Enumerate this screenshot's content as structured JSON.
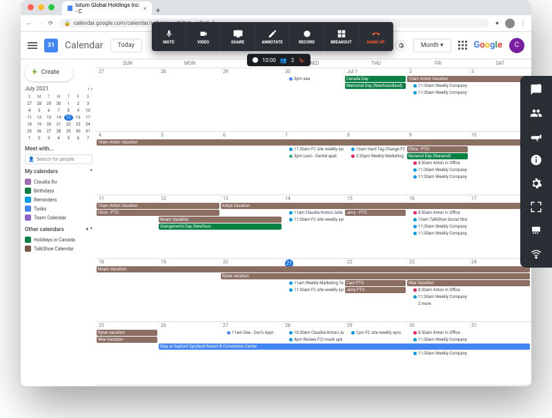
{
  "browser": {
    "tab_title": "Iotum Global Holdings Inc. - C",
    "url": "calendar.google.com/calendar/u/0/r/month?tab=rc&pli=1"
  },
  "header": {
    "app": "Calendar",
    "today": "Today",
    "view": "Month",
    "google": "Google",
    "avatar": "C"
  },
  "toolbar": {
    "mute": "MUTE",
    "video": "VIDEO",
    "share": "SHARE",
    "annotate": "ANNOTATE",
    "record": "RECORD",
    "breakout": "BREAKOUT",
    "hangup": "HANG UP"
  },
  "pill": {
    "time": "10:00",
    "count": "2"
  },
  "sidebar": {
    "create": "Create",
    "month_label": "July 2021",
    "dow": [
      "S",
      "M",
      "T",
      "W",
      "T",
      "F",
      "S"
    ],
    "mini_rows": [
      [
        "27",
        "28",
        "29",
        "30",
        "1",
        "2",
        "3"
      ],
      [
        "4",
        "5",
        "6",
        "7",
        "8",
        "9",
        "10"
      ],
      [
        "11",
        "12",
        "13",
        "14",
        "15",
        "16",
        "17"
      ],
      [
        "18",
        "19",
        "20",
        "21",
        "22",
        "23",
        "24"
      ],
      [
        "25",
        "26",
        "27",
        "28",
        "29",
        "30",
        "31"
      ],
      [
        "1",
        "2",
        "3",
        "4",
        "5",
        "6",
        "7"
      ]
    ],
    "mini_today": "15",
    "meet_label": "Meet with...",
    "search_ph": "Search for people",
    "mycal_label": "My calendars",
    "mycals": [
      {
        "label": "Claudia Xu",
        "color": "#9e69af"
      },
      {
        "label": "Birthdays",
        "color": "#0b8043"
      },
      {
        "label": "Reminders",
        "color": "#039be5"
      },
      {
        "label": "Tasks",
        "color": "#4285f4"
      },
      {
        "label": "Team Calendar",
        "color": "#8e63ce"
      }
    ],
    "other_label": "Other calendars",
    "others": [
      {
        "label": "Holidays in Canada",
        "color": "#0b8043"
      },
      {
        "label": "TalkShoe Calendar",
        "color": "#795548"
      }
    ]
  },
  "grid": {
    "dow": [
      "Sun",
      "Mon",
      "Tue",
      "Wed",
      "Thu",
      "Fri",
      "Sat"
    ],
    "weeks": [
      {
        "dates": [
          "27",
          "28",
          "29",
          "30",
          "Jul 1",
          "2",
          "3"
        ],
        "events": [
          {
            "col": 3,
            "span": 1,
            "row": 0,
            "kind": "dot",
            "dotcolor": "#4285f4",
            "text": "3pm sea"
          },
          {
            "col": 4,
            "span": 1,
            "row": 0,
            "bg": "#0b8043",
            "text": "Canada Day"
          },
          {
            "col": 4,
            "span": 1,
            "row": 1,
            "bg": "#0b8043",
            "text": "Memorial Day (Newfoundland)"
          },
          {
            "col": 5,
            "span": 2,
            "row": 0,
            "bg": "#8d6e63",
            "text": "10am Anton Vacation"
          },
          {
            "col": 5,
            "span": 1,
            "row": 1,
            "kind": "dot",
            "dotcolor": "#039be5",
            "text": "11:30am Weekly Company"
          },
          {
            "col": 5,
            "span": 1,
            "row": 2,
            "kind": "dot",
            "dotcolor": "#039be5",
            "text": "11:30am Weekly Company"
          }
        ]
      },
      {
        "dates": [
          "4",
          "5",
          "6",
          "7",
          "8",
          "9",
          "10"
        ],
        "events": [
          {
            "col": 0,
            "span": 7,
            "row": 0,
            "bg": "#8d6e63",
            "text": "10am Anton Vacation"
          },
          {
            "col": 3,
            "span": 1,
            "row": 1,
            "kind": "dot",
            "dotcolor": "#039be5",
            "text": "11:30am FC site weekly syn"
          },
          {
            "col": 3,
            "span": 1,
            "row": 2,
            "kind": "dot",
            "dotcolor": "#33b679",
            "text": "3pm Leon - Dental appt."
          },
          {
            "col": 4,
            "span": 1,
            "row": 1,
            "kind": "dot",
            "dotcolor": "#039be5",
            "text": "10am Hard Tag Change FCI"
          },
          {
            "col": 4,
            "span": 1,
            "row": 2,
            "kind": "dot",
            "dotcolor": "#e91e63",
            "text": "3:30pm Weekly Marketing"
          },
          {
            "col": 5,
            "span": 1,
            "row": 1,
            "bg": "#8d6e63",
            "text": "Chris - PTO"
          },
          {
            "col": 5,
            "span": 1,
            "row": 2,
            "bg": "#0b8043",
            "text": "Nunavut Day (Nunavut)"
          },
          {
            "col": 5,
            "span": 1,
            "row": 3,
            "kind": "dot",
            "dotcolor": "#e91e63",
            "text": "8:30am Anton in Office"
          },
          {
            "col": 5,
            "span": 1,
            "row": 4,
            "kind": "dot",
            "dotcolor": "#039be5",
            "text": "11:30am Weekly Company"
          },
          {
            "col": 5,
            "span": 1,
            "row": 5,
            "kind": "dot",
            "dotcolor": "#039be5",
            "text": "11:30am Weekly Company"
          }
        ]
      },
      {
        "dates": [
          "11",
          "12",
          "13",
          "14",
          "15",
          "16",
          "17"
        ],
        "events": [
          {
            "col": 0,
            "span": 2,
            "row": 0,
            "bg": "#8d6e63",
            "text": "10am Anton Vacation"
          },
          {
            "col": 0,
            "span": 2,
            "row": 1,
            "bg": "#8d6e63",
            "text": "Chris - PTO"
          },
          {
            "col": 2,
            "span": 5,
            "row": 0,
            "bg": "#8d6e63",
            "text": "Katya Vacation"
          },
          {
            "col": 1,
            "span": 2,
            "row": 2,
            "bg": "#8d6e63",
            "text": "Noam Vacation"
          },
          {
            "col": 1,
            "span": 2,
            "row": 3,
            "bg": "#0b8043",
            "text": "Orangemen's Day (Newfoun"
          },
          {
            "col": 3,
            "span": 1,
            "row": 1,
            "kind": "dot",
            "dotcolor": "#039be5",
            "text": "11am Claudia/Anton/Julia"
          },
          {
            "col": 3,
            "span": 1,
            "row": 2,
            "kind": "dot",
            "dotcolor": "#039be5",
            "text": "11:30am FC site weekly syn"
          },
          {
            "col": 4,
            "span": 1,
            "row": 1,
            "bg": "#8d6e63",
            "text": "Jerry - PTO"
          },
          {
            "col": 5,
            "span": 1,
            "row": 1,
            "kind": "dot",
            "dotcolor": "#e91e63",
            "text": "8:30am Anton in Office"
          },
          {
            "col": 5,
            "span": 1,
            "row": 2,
            "kind": "dot",
            "dotcolor": "#039be5",
            "text": "10am TalkShoe Social Stra"
          },
          {
            "col": 5,
            "span": 1,
            "row": 3,
            "kind": "dot",
            "dotcolor": "#039be5",
            "text": "11:30am Weekly Company"
          },
          {
            "col": 5,
            "span": 1,
            "row": 4,
            "kind": "dot",
            "dotcolor": "#039be5",
            "text": "11:30am Weekly Company"
          }
        ]
      },
      {
        "dates": [
          "18",
          "19",
          "20",
          "21",
          "22",
          "23",
          "24"
        ],
        "events": [
          {
            "col": 0,
            "span": 7,
            "row": 0,
            "bg": "#8d6e63",
            "text": "Noam Vacation"
          },
          {
            "col": 2,
            "span": 5,
            "row": 1,
            "bg": "#8d6e63",
            "text": "Rynei vacation"
          },
          {
            "col": 3,
            "span": 1,
            "row": 2,
            "kind": "dot",
            "dotcolor": "#039be5",
            "text": "11am Weekly Marketing Te"
          },
          {
            "col": 3,
            "span": 1,
            "row": 3,
            "kind": "dot",
            "dotcolor": "#039be5",
            "text": "11:30am FC site weekly syn"
          },
          {
            "col": 4,
            "span": 1,
            "row": 2,
            "bg": "#8d6e63",
            "text": "Cam PTO"
          },
          {
            "col": 4,
            "span": 1,
            "row": 3,
            "bg": "#8d6e63",
            "text": "Jerry PTO"
          },
          {
            "col": 5,
            "span": 2,
            "row": 2,
            "bg": "#8d6e63",
            "text": "Wes Vacation"
          },
          {
            "col": 5,
            "span": 1,
            "row": 3,
            "kind": "dot",
            "dotcolor": "#e91e63",
            "text": "8:30am Anton in Office"
          },
          {
            "col": 5,
            "span": 1,
            "row": 4,
            "kind": "dot",
            "dotcolor": "#039be5",
            "text": "11:30am Weekly Company"
          },
          {
            "col": 5,
            "span": 1,
            "row": 5,
            "text": "2 more",
            "kind": "dot",
            "dotcolor": "transparent"
          }
        ]
      },
      {
        "dates": [
          "25",
          "26",
          "27",
          "28",
          "29",
          "30",
          "31"
        ],
        "events": [
          {
            "col": 0,
            "span": 1,
            "row": 0,
            "bg": "#8d6e63",
            "text": "Rynei vacation"
          },
          {
            "col": 0,
            "span": 1,
            "row": 1,
            "bg": "#8d6e63",
            "text": "Wes Vacation"
          },
          {
            "col": 1,
            "span": 6,
            "row": 2,
            "bg": "#4285f4",
            "text": "Stay at Gaylord Opryland Resort & Convention Center"
          },
          {
            "col": 2,
            "span": 1,
            "row": 0,
            "kind": "dot",
            "dotcolor": "#4285f4",
            "text": "11am Dee - Doc's Appt"
          },
          {
            "col": 3,
            "span": 1,
            "row": 0,
            "kind": "dot",
            "dotcolor": "#039be5",
            "text": "10:30am Claudia/Anton/Ju"
          },
          {
            "col": 3,
            "span": 1,
            "row": 1,
            "kind": "dot",
            "dotcolor": "#039be5",
            "text": "4pm Review FCI mock ups"
          },
          {
            "col": 4,
            "span": 1,
            "row": 0,
            "kind": "dot",
            "dotcolor": "#039be5",
            "text": "1pm FC site weekly sync"
          },
          {
            "col": 5,
            "span": 1,
            "row": 0,
            "kind": "dot",
            "dotcolor": "#e91e63",
            "text": "8:30am Anton in Office"
          },
          {
            "col": 5,
            "span": 1,
            "row": 1,
            "kind": "dot",
            "dotcolor": "#039be5",
            "text": "11:30am Weekly Company"
          },
          {
            "col": 5,
            "span": 1,
            "row": 3,
            "kind": "dot",
            "dotcolor": "#039be5",
            "text": "11:30am Weekly Company"
          }
        ]
      }
    ]
  }
}
